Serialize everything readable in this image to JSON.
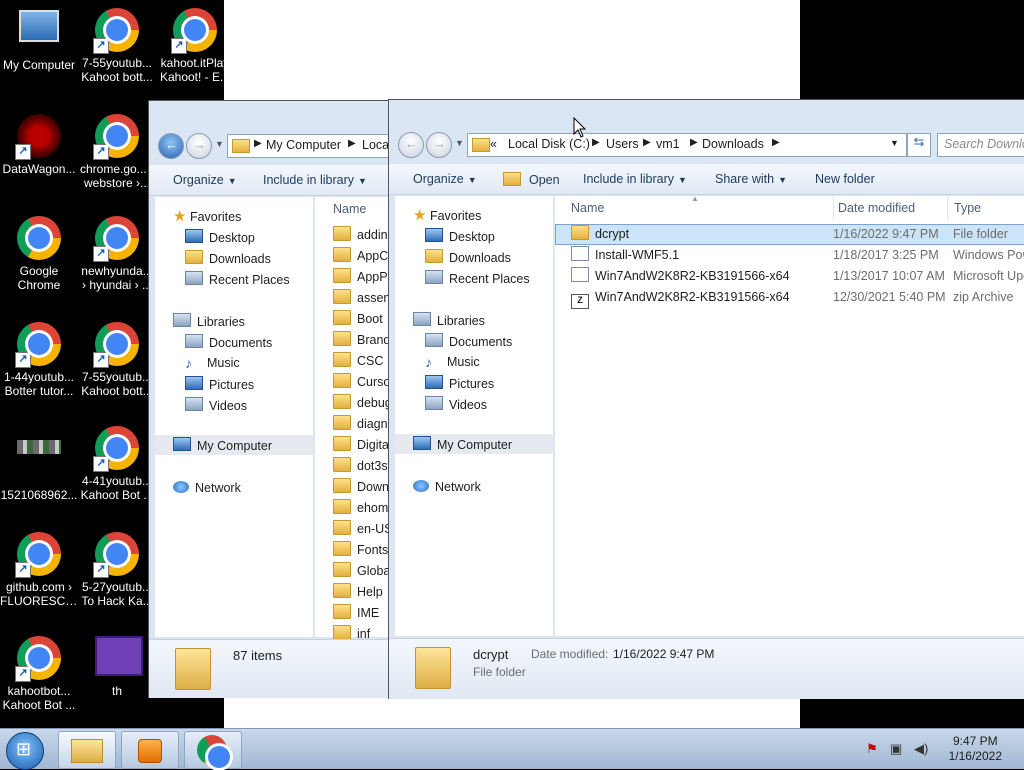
{
  "desktop": {
    "icons": [
      {
        "label": "My Computer",
        "type": "computer"
      },
      {
        "label": "DataWagon...",
        "type": "datawagon"
      },
      {
        "label": "Google Chrome",
        "type": "chrome"
      },
      {
        "label": "1-44youtub... Botter tutor...",
        "type": "chrome"
      },
      {
        "label": "1521068962...",
        "type": "image"
      },
      {
        "label": "github.com › FLUORESCE...",
        "type": "chrome"
      },
      {
        "label": "kahootbot... Kahoot Bot ...",
        "type": "chrome"
      },
      {
        "label": "7-55youtub... Kahoot bott...",
        "type": "chrome"
      },
      {
        "label": "chrome.go... › webstore ›...",
        "type": "chrome"
      },
      {
        "label": "newhyunda... › hyundai › ...",
        "type": "chrome"
      },
      {
        "label": "7-55youtub... Kahoot bott...",
        "type": "chrome"
      },
      {
        "label": "4-41youtub... Kahoot Bot ...",
        "type": "chrome"
      },
      {
        "label": "5-27youtub... To Hack Ka...",
        "type": "chrome"
      },
      {
        "label": "th",
        "type": "purple"
      },
      {
        "label": "kahoot.itPlay Kahoot! - E...",
        "type": "chrome"
      }
    ]
  },
  "back_window": {
    "breadcrumb": [
      "My Computer",
      "Loca"
    ],
    "toolbar": {
      "organize": "Organize",
      "include": "Include in library"
    },
    "nav": {
      "favorites": "Favorites",
      "desktop": "Desktop",
      "downloads": "Downloads",
      "recent": "Recent Places",
      "libraries": "Libraries",
      "documents": "Documents",
      "music": "Music",
      "pictures": "Pictures",
      "videos": "Videos",
      "computer": "My Computer",
      "network": "Network"
    },
    "column_name": "Name",
    "files": [
      "addins",
      "AppCo",
      "AppPa",
      "assem",
      "Boot",
      "Brandi",
      "CSC",
      "Cursor",
      "debug",
      "diagno",
      "Digital",
      "dot3sv",
      "Downl",
      "ehome",
      "en-US",
      "Fonts",
      "Global",
      "Help",
      "IME",
      "inf"
    ],
    "status": "87 items"
  },
  "front_window": {
    "breadcrumb": {
      "prefix": "«",
      "parts": [
        "Local Disk (C:)",
        "Users",
        "vm1",
        "Downloads"
      ]
    },
    "search_placeholder": "Search Downlo",
    "toolbar": {
      "organize": "Organize",
      "open": "Open",
      "include": "Include in library",
      "share": "Share with",
      "new_folder": "New folder"
    },
    "nav": {
      "favorites": "Favorites",
      "desktop": "Desktop",
      "downloads": "Downloads",
      "recent": "Recent Places",
      "libraries": "Libraries",
      "documents": "Documents",
      "music": "Music",
      "pictures": "Pictures",
      "videos": "Videos",
      "computer": "My Computer",
      "network": "Network"
    },
    "columns": {
      "name": "Name",
      "date": "Date modified",
      "type": "Type"
    },
    "files": [
      {
        "name": "dcrypt",
        "date": "1/16/2022 9:47 PM",
        "type": "File folder",
        "icon": "folder-icon",
        "selected": true
      },
      {
        "name": "Install-WMF5.1",
        "date": "1/18/2017 3:25 PM",
        "type": "Windows Pow",
        "icon": "script-icon",
        "selected": false
      },
      {
        "name": "Win7AndW2K8R2-KB3191566-x64",
        "date": "1/13/2017 10:07 AM",
        "type": "Microsoft Upd",
        "icon": "installer-icon",
        "selected": false
      },
      {
        "name": "Win7AndW2K8R2-KB3191566-x64",
        "date": "12/30/2021 5:40 PM",
        "type": "zip Archive",
        "icon": "zip-icon",
        "selected": false
      }
    ],
    "details": {
      "name": "dcrypt",
      "date_label": "Date modified:",
      "date": "1/16/2022 9:47 PM",
      "type": "File folder"
    }
  },
  "taskbar": {
    "time": "9:47 PM",
    "date": "1/16/2022"
  }
}
